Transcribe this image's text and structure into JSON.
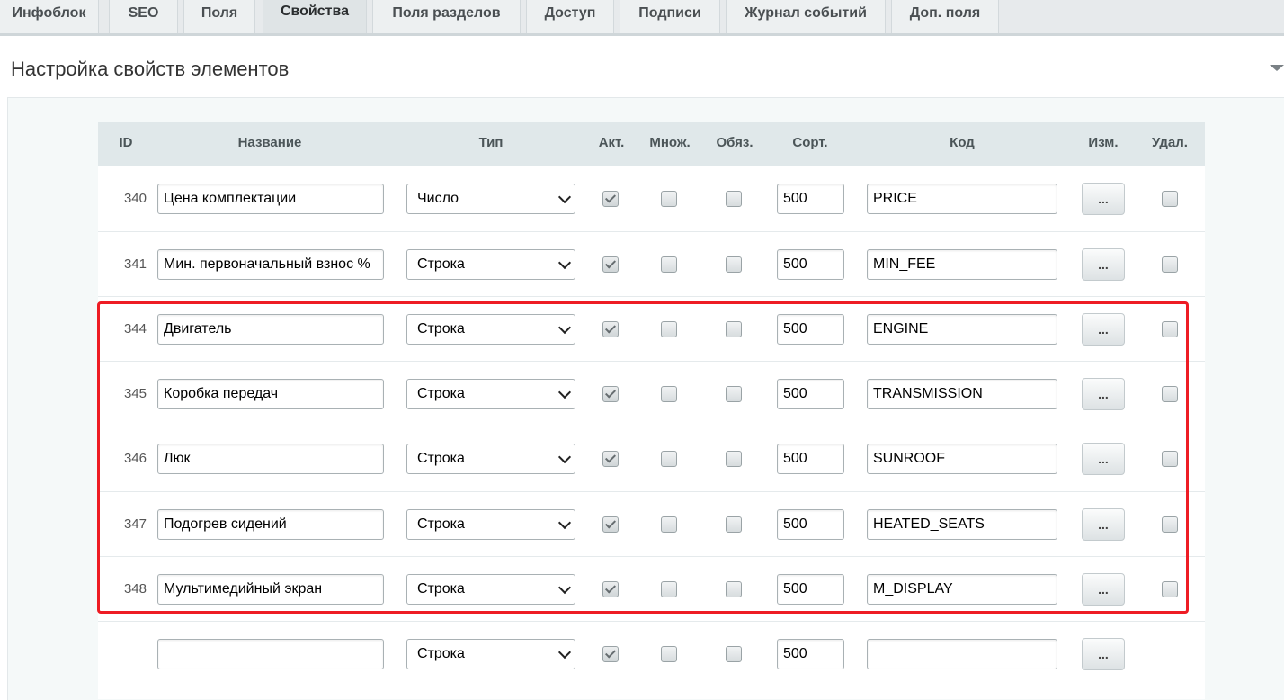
{
  "tabs": [
    {
      "label": "Инфоблок"
    },
    {
      "label": "SEO"
    },
    {
      "label": "Поля"
    },
    {
      "label": "Свойства"
    },
    {
      "label": "Поля разделов"
    },
    {
      "label": "Доступ"
    },
    {
      "label": "Подписи"
    },
    {
      "label": "Журнал событий"
    },
    {
      "label": "Доп. поля"
    }
  ],
  "active_tab": "Свойства",
  "page_title": "Настройка свойств элементов",
  "columns": {
    "id": "ID",
    "name": "Название",
    "type": "Тип",
    "active": "Акт.",
    "multiple": "Множ.",
    "required": "Обяз.",
    "sort": "Сорт.",
    "code": "Код",
    "edit": "Изм.",
    "delete": "Удал."
  },
  "edit_button_label": "...",
  "rows": [
    {
      "id": "340",
      "name": "Цена комплектации",
      "type": "Число",
      "active": true,
      "multiple": false,
      "required": false,
      "sort": "500",
      "code": "PRICE",
      "delete": false
    },
    {
      "id": "341",
      "name": "Мин. первоначальный взнос %",
      "type": "Строка",
      "active": true,
      "multiple": false,
      "required": false,
      "sort": "500",
      "code": "MIN_FEE",
      "delete": false
    },
    {
      "id": "344",
      "name": "Двигатель",
      "type": "Строка",
      "active": true,
      "multiple": false,
      "required": false,
      "sort": "500",
      "code": "ENGINE",
      "delete": false
    },
    {
      "id": "345",
      "name": "Коробка передач",
      "type": "Строка",
      "active": true,
      "multiple": false,
      "required": false,
      "sort": "500",
      "code": "TRANSMISSION",
      "delete": false
    },
    {
      "id": "346",
      "name": "Люк",
      "type": "Строка",
      "active": true,
      "multiple": false,
      "required": false,
      "sort": "500",
      "code": "SUNROOF",
      "delete": false
    },
    {
      "id": "347",
      "name": "Подогрев сидений",
      "type": "Строка",
      "active": true,
      "multiple": false,
      "required": false,
      "sort": "500",
      "code": "HEATED_SEATS",
      "delete": false
    },
    {
      "id": "348",
      "name": "Мультимедийный экран",
      "type": "Строка",
      "active": true,
      "multiple": false,
      "required": false,
      "sort": "500",
      "code": "M_DISPLAY",
      "delete": false
    },
    {
      "id": "",
      "name": "",
      "type": "Строка",
      "active": true,
      "multiple": false,
      "required": false,
      "sort": "500",
      "code": "",
      "delete": null
    }
  ],
  "colors": {
    "highlight": "#ee1c24",
    "header_bg": "#e0e8ea",
    "tabs_bg": "#e7eaec"
  }
}
